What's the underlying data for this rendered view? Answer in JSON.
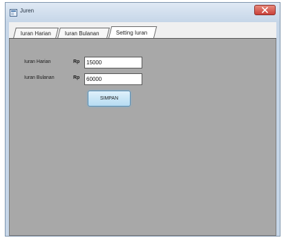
{
  "window": {
    "title": "Juren",
    "close_icon": "close-icon",
    "app_icon": "app-icon"
  },
  "tabs": [
    {
      "label": "Iuran Harian",
      "active": false
    },
    {
      "label": "Iuran Bulanan",
      "active": false
    },
    {
      "label": "Setting Iuran",
      "active": true
    }
  ],
  "form": {
    "daily": {
      "label": "Iuran Harian",
      "currency": "Rp",
      "value": "15000"
    },
    "monthly": {
      "label": "Iuran Bulanan",
      "currency": "Rp",
      "value": "60000"
    },
    "save_label": "SIMPAN"
  },
  "colors": {
    "panel_bg": "#a8a8a8",
    "close_button": "#c9413a",
    "save_button": "#b6dcf2"
  }
}
